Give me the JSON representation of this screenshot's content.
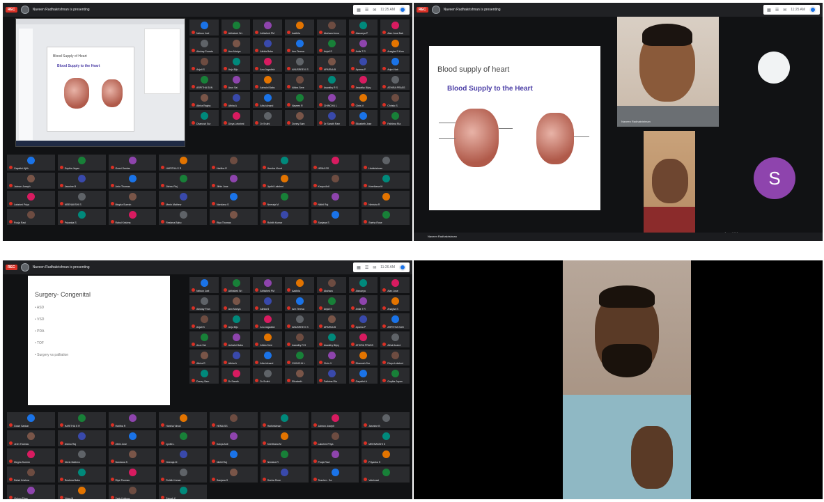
{
  "panel1": {
    "presenting_label": "Naveen Radhakrishnan is presenting",
    "rec_label": "REC",
    "time": "11:25 AM",
    "slide_title": "Blood Supply of Heart",
    "slide_heading": "Blood Supply to the Heart",
    "tiles_right": [
      "Nelson Joel",
      "Abhishek Sri..",
      "Abhishek PM",
      "Aadhila",
      "Akshara Anna",
      "Aiswarya P",
      "Alan Jose Bab",
      "Akshay Francis",
      "Ann Mariya",
      "Akhila Babu",
      "Ann Teresa",
      "Anjali S",
      "Anila T R",
      "Anagha S Kum",
      "Anjali S",
      "Anju Biju",
      "Anu Jagadish",
      "ANUSREE K S",
      "APARNA B",
      "Aparna P",
      "Arjun Nair",
      "ARPITHA SUN",
      "Arun Sai",
      "Ashwini Babu",
      "Athira Sree",
      "Aswathy R S",
      "Aswathy Bijoy",
      "ATHIRA PRASS",
      "Athira Raghu",
      "Athira A",
      "Athul Anand",
      "Naveen R",
      "CHINCHU L",
      "Chris V",
      "Christo S",
      "Dhanush Sur",
      "Divya Lekshmi",
      "Dr Sruthi",
      "Doney Sam",
      "Dr Sarath Ram",
      "Elizabeth Jose",
      "Fathima Ria"
    ],
    "tiles_bottom": [
      "Gayathri Ajith",
      "Gopika Jayan",
      "Gowri Sankar",
      "HARITHA S R",
      "Haritha R",
      "Harsha Vinod",
      "HEMA SS",
      "Harikrishnan",
      "Jaimon Joseph",
      "Jasmine B",
      "Jerin Thomas",
      "Jishnu Raj",
      "Jithin Jose",
      "Jyothi Lakshmi",
      "Kavya Anil",
      "Keerthana M",
      "Lakshmi Priya",
      "MEENAKSHI S",
      "Megha Suresh",
      "Merin Mathew",
      "Nandana S",
      "Neeraja M",
      "Nikhil Raj",
      "Nimisha R",
      "Pooja Ravi",
      "Priyanka S",
      "Rahul Krishna",
      "Reshma Babu",
      "Riya Thomas",
      "Rohith Kumar",
      "Sanjana S",
      "Sneha Rose"
    ]
  },
  "panel2": {
    "presenting_label": "Naveen Radhakrishnan is presenting",
    "rec_label": "REC",
    "time": "11:25 AM",
    "slide_title": "Blood supply of heart",
    "slide_heading": "Blood Supply to the Heart",
    "video1_label": "Naveen Radhakrishnan",
    "video2_label": "Jayanthi Menon",
    "s_letter": "S",
    "bottom_label": "Naveen Radhakrishnan"
  },
  "panel3": {
    "presenting_label": "Naveen Radhakrishnan is presenting",
    "rec_label": "REC",
    "time": "11:26 AM",
    "slide_title": "Surgery- Congenital",
    "bullets": [
      "ASD",
      "VSD",
      "PDA",
      "TOF",
      "Surgery vs palliation"
    ],
    "tiles_right": [
      "Nelson Joel",
      "Abhishek Sri",
      "Abhishek PM",
      "Aadhila",
      "Akshara",
      "Aiswarya",
      "Alan Jose",
      "Akshay Fran",
      "Ann Mariya",
      "Akhila B",
      "Ann Teresa",
      "Anjali S",
      "Anila T R",
      "Anagha S",
      "Anjali S",
      "Anju Biju",
      "Anu Jagadish",
      "ANUSREE K S",
      "APARNA B",
      "Aparna P",
      "ARPITHA SUN",
      "Arun Sai",
      "Ashwini Babu",
      "Athira Sree",
      "Aswathy R S",
      "Aswathy Bijoy",
      "ATHIRA PRASS",
      "Athul Anand",
      "Athira R",
      "Athira A",
      "Athul Anand",
      "CHINCHU L",
      "Chris V",
      "Dhanush Sur",
      "Divya Lekshmi",
      "Doney Sam",
      "Dr Sarath",
      "Dr Sruthi",
      "Elizabeth",
      "Fathima Ria",
      "Gayathri A",
      "Gopika Jayan"
    ],
    "tiles_bottom": [
      "Gowri Sankar",
      "HARITHA S R",
      "Haritha R",
      "Harsha Vinod",
      "HEMA SS",
      "Harikrishnan",
      "Jaimon Joseph",
      "Jasmine B",
      "Jerin Thomas",
      "Jishnu Raj",
      "Jithin Jose",
      "Jyothi L",
      "Kavya Anil",
      "Keerthana M",
      "Lakshmi Priya",
      "MEENAKSHI S",
      "Megha Suresh",
      "Merin Mathew",
      "Nandana S",
      "Neeraja M",
      "Nikhil Raj",
      "Nimisha R",
      "Pooja Ravi",
      "Priyanka S",
      "Rahul Krishna",
      "Reshma Babu",
      "Riya Thomas",
      "Rohith Kumar",
      "Sanjana S",
      "Sneha Rose",
      "Teacher - Sa",
      "Vaishnavi",
      "Vishnu Priya",
      "Vidya M",
      "Yadu Krishna",
      "Zainab K"
    ]
  },
  "colors": {
    "meet_bg": "#111214",
    "tile_bg": "#2a2b2e",
    "rec_red": "#d93025",
    "slide_heading": "#4b3ea6",
    "avatar_purple": "#8e44ad"
  }
}
